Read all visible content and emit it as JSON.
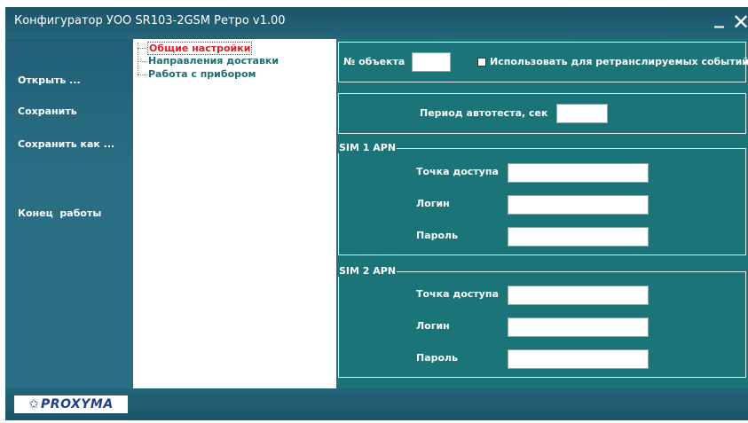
{
  "window": {
    "title": "Конфигуратор УОО SR103-2GSM Ретро v1.00",
    "minimize_glyph": "_",
    "close_glyph": "✕"
  },
  "sidebar": {
    "open_label": "Открыть ...",
    "save_label": "Сохранить",
    "save_as_label": "Сохранить как ...",
    "exit_label": "Конец  работы"
  },
  "tree": {
    "items": [
      {
        "label": "Общие настройки",
        "selected": true
      },
      {
        "label": "Направления доставки",
        "selected": false
      },
      {
        "label": "Работа с прибором",
        "selected": false
      }
    ]
  },
  "general": {
    "object_number_label": "№ объекта",
    "object_number_value": "",
    "retransmit_label": "Использовать для ретранслируемых событий",
    "retransmit_checked": false,
    "autotest_label": "Период автотеста, сек",
    "autotest_value": ""
  },
  "sim1": {
    "legend": "SIM 1 APN",
    "access_point_label": "Точка доступа",
    "access_point_value": "",
    "login_label": "Логин",
    "login_value": "",
    "password_label": "Пароль",
    "password_value": ""
  },
  "sim2": {
    "legend": "SIM 2 APN",
    "access_point_label": "Точка доступа",
    "access_point_value": "",
    "login_label": "Логин",
    "login_value": "",
    "password_label": "Пароль",
    "password_value": ""
  },
  "footer": {
    "logo_text": "PROXYMA",
    "logo_icon": "star-icon"
  },
  "colors": {
    "window_bg": "#2a6e84",
    "content_bg": "#1a7478",
    "selected_item": "#d8222a",
    "tree_item": "#1b6e74",
    "logo": "#1e3f8c"
  }
}
